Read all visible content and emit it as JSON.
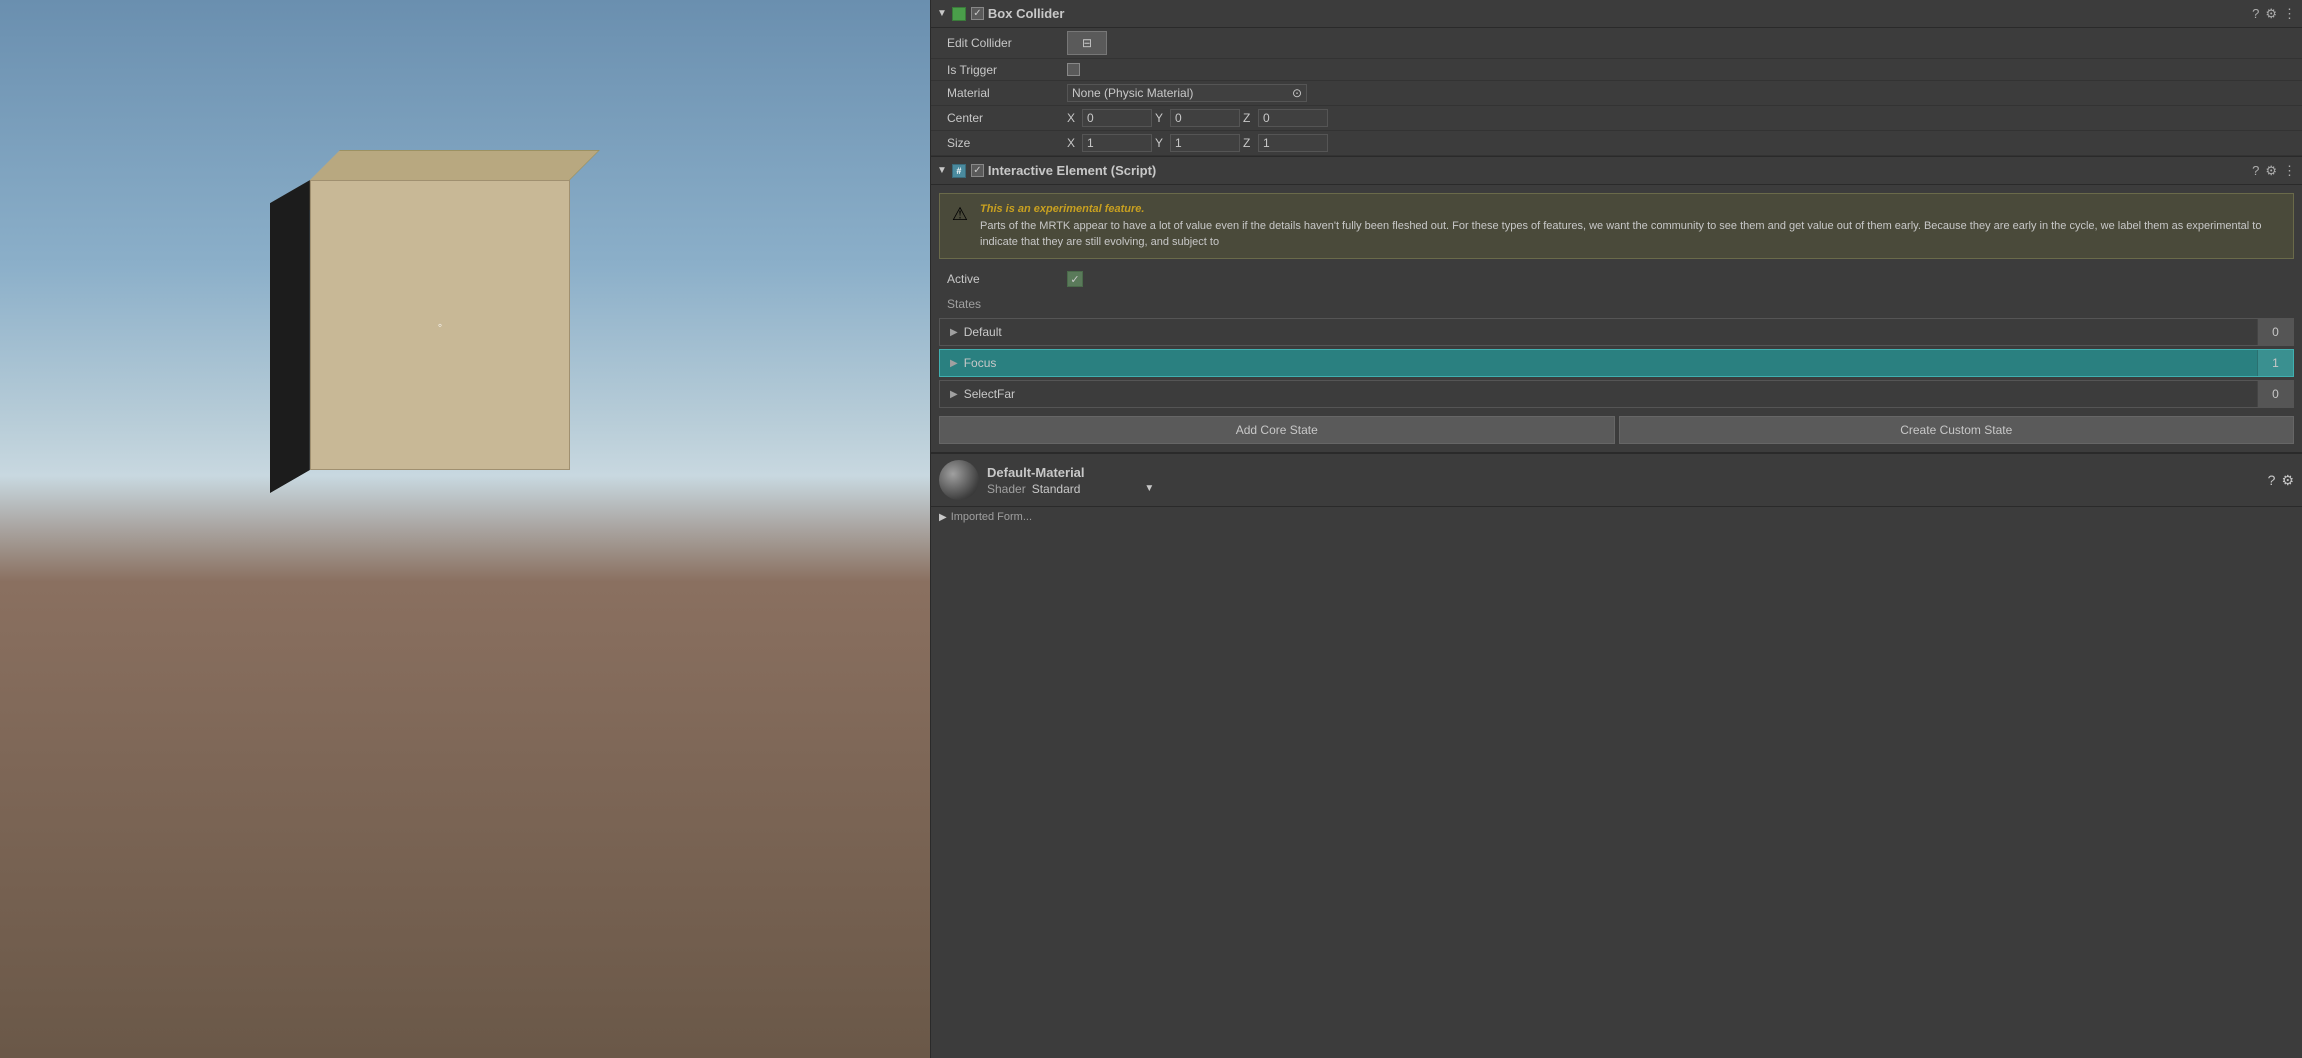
{
  "viewport": {
    "label": "Scene Viewport"
  },
  "inspector": {
    "boxCollider": {
      "title": "Box Collider",
      "editColliderLabel": "Edit Collider",
      "isTriggerLabel": "Is Trigger",
      "materialLabel": "Material",
      "materialValue": "None (Physic Material)",
      "centerLabel": "Center",
      "centerX": "0",
      "centerY": "0",
      "centerZ": "0",
      "sizeLabel": "Size",
      "sizeX": "1",
      "sizeY": "1",
      "sizeZ": "1"
    },
    "interactiveElement": {
      "title": "Interactive Element (Script)",
      "warningTitle": "This is an experimental feature.",
      "warningBody": "Parts of the MRTK appear to have a lot of value even if the details haven't fully been fleshed out. For these types of features, we want the community to see them and get value out of them early. Because they are early in the cycle, we label them as experimental to indicate that they are still evolving, and subject to",
      "activeLabel": "Active",
      "statesLabel": "States",
      "states": [
        {
          "name": "Default",
          "count": "0",
          "active": false
        },
        {
          "name": "Focus",
          "count": "1",
          "active": true
        },
        {
          "name": "SelectFar",
          "count": "0",
          "active": false
        }
      ],
      "addCoreStateLabel": "Add Core State",
      "createCustomStateLabel": "Create Custom State"
    },
    "material": {
      "name": "Default-Material",
      "shaderLabel": "Shader",
      "shaderValue": "Standard"
    }
  },
  "icons": {
    "collapseArrow": "▼",
    "expandArrow": "▶",
    "questionMark": "?",
    "settingsGear": "⚙",
    "moreOptions": "⋮",
    "editIcon": "⊟",
    "checkmark": "✓",
    "warningSymbol": "⚠",
    "crosshair": "◦",
    "dropdownArrow": "▼"
  }
}
